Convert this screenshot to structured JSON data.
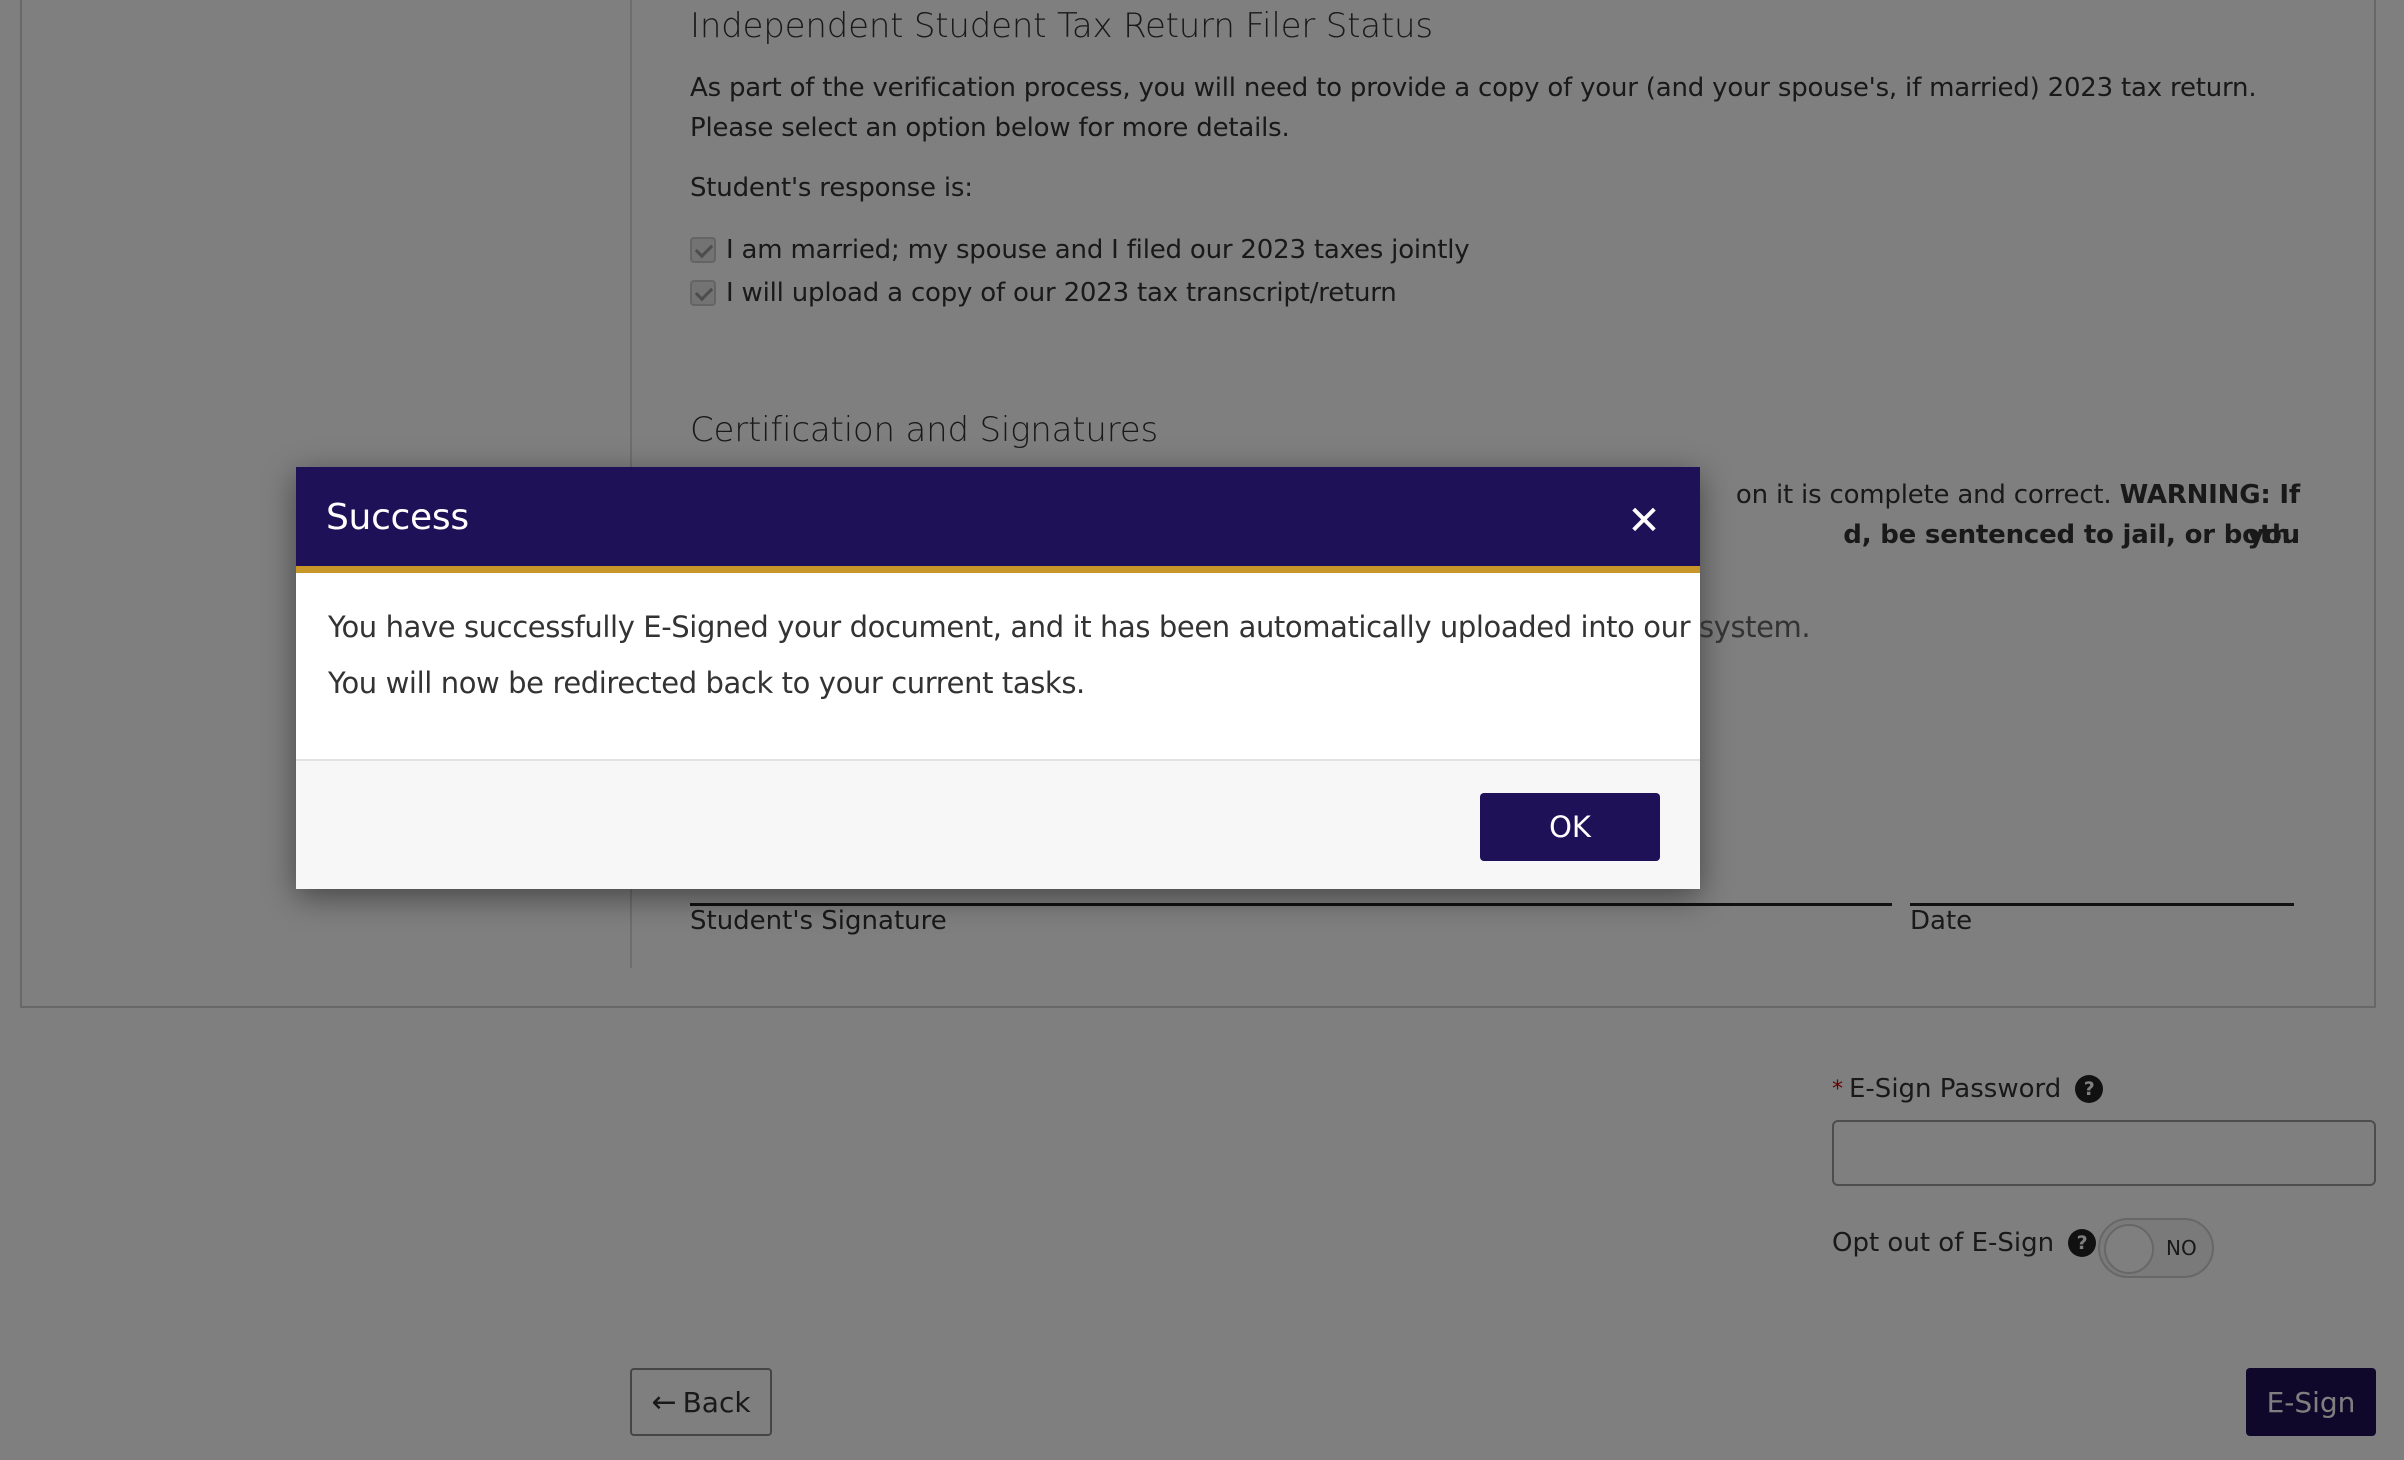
{
  "document": {
    "filer_status_section": {
      "title": "Independent Student Tax Return Filer Status",
      "description": "As part of the verification process, you will need to provide a copy of your (and your spouse's, if married) 2023 tax return. Please select an option below for more details.",
      "response_label": "Student's response is:",
      "options": [
        {
          "label": "I am married; my spouse and I filed our 2023 taxes jointly",
          "checked": true
        },
        {
          "label": "I will upload a copy of our 2023 tax transcript/return",
          "checked": true
        }
      ]
    },
    "certification_section": {
      "title": "Certification and Signatures",
      "partial_text_line1": "on it is complete and correct.",
      "warning_line1": "WARNING: If you",
      "warning_line2": "d, be sentenced to jail, or both."
    },
    "signature": {
      "student_label": "Student's Signature",
      "date_label": "Date"
    }
  },
  "form": {
    "esign_password": {
      "label": "E-Sign Password",
      "required_mark": "*",
      "help_icon": "question-circle-icon",
      "value": "",
      "placeholder": ""
    },
    "opt_out": {
      "label": "Opt out of E-Sign",
      "help_icon": "question-circle-icon",
      "toggle_text": "NO"
    },
    "back_button": {
      "icon": "arrow-left-icon",
      "label": "Back"
    },
    "esign_button": {
      "label": "E-Sign"
    }
  },
  "modal": {
    "title": "Success",
    "close_icon": "close-icon",
    "message_line1": "You have successfully E-Signed your document, and it has been automatically uploaded into our system.",
    "message_line2": "You will now be redirected back to your current tasks.",
    "ok_label": "OK"
  },
  "colors": {
    "brand_primary": "#1f1157",
    "accent_gold": "#c9962a",
    "overlay": "rgba(0,0,0,0.5)"
  }
}
